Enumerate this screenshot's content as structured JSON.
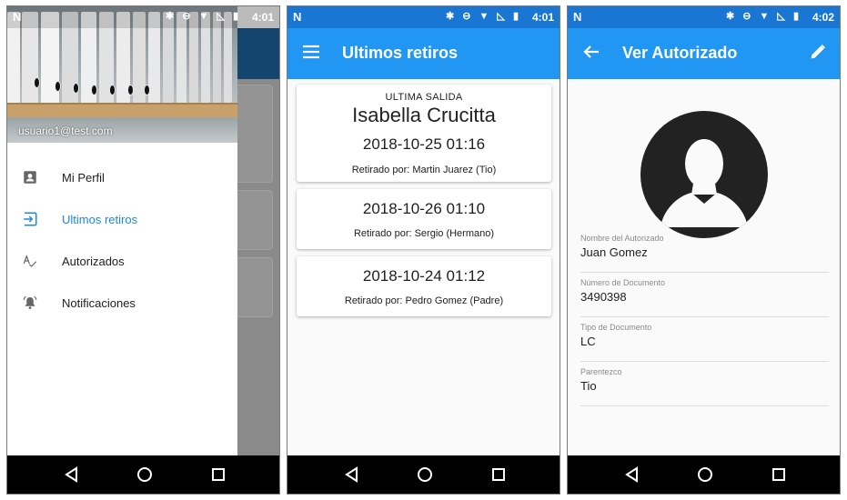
{
  "status": {
    "carrier_glyph": "N",
    "icons": "✱ ⊖ ▼ ◺ ▮",
    "time_1": "4:01",
    "time_2": "4:01",
    "time_3": "4:02"
  },
  "drawer": {
    "email": "usuario1@test.com",
    "items": [
      {
        "label": "Mi Perfil",
        "icon": "person-card-icon",
        "active": false
      },
      {
        "label": "Ultimos retiros",
        "icon": "login-arrow-icon",
        "active": true
      },
      {
        "label": "Autorizados",
        "icon": "spellcheck-icon",
        "active": false
      },
      {
        "label": "Notificaciones",
        "icon": "bell-ringing-icon",
        "active": false
      }
    ]
  },
  "retiros": {
    "title": "Ultimos retiros",
    "cards": [
      {
        "kicker": "ULTIMA SALIDA",
        "name": "Isabella Crucitta",
        "date": "2018-10-25 01:16",
        "by": "Retirado por: Martin Juarez (Tio)"
      },
      {
        "date": "2018-10-26 01:10",
        "by": "Retirado por: Sergio (Hermano)"
      },
      {
        "date": "2018-10-24 01:12",
        "by": "Retirado por: Pedro Gomez (Padre)"
      }
    ]
  },
  "autorizado": {
    "title": "Ver Autorizado",
    "fields": [
      {
        "label": "Nombre del Autorizado",
        "value": "Juan Gomez"
      },
      {
        "label": "Número de Documento",
        "value": "3490398"
      },
      {
        "label": "Tipo de Documento",
        "value": "LC"
      },
      {
        "label": "Parentezco",
        "value": "Tio"
      }
    ]
  },
  "colors": {
    "primary": "#2196f3",
    "status_bar": "#1976d2",
    "accent": "#1e88e5",
    "nav_bar": "#000000"
  }
}
